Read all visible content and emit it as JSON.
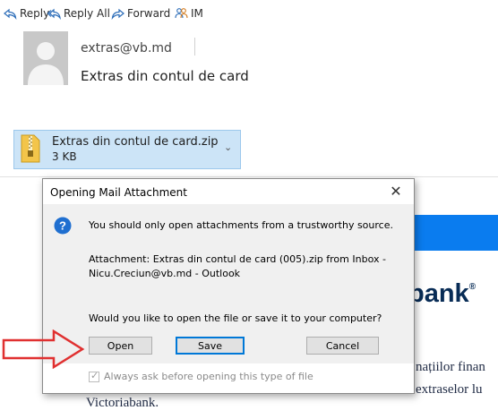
{
  "toolbar": {
    "reply_label": "Reply",
    "reply_all_label": "Reply All",
    "forward_label": "Forward",
    "im_label": "IM"
  },
  "message": {
    "from": "extras@vb.md",
    "subject": "Extras din contul de card"
  },
  "attachment": {
    "name": "Extras din contul de card.zip",
    "size": "3 KB"
  },
  "background": {
    "bank_text": "bank",
    "bank_mark": "®",
    "line1": "națiilor finan",
    "line2": "extraselor lu",
    "line3": "Victoriabank."
  },
  "dialog": {
    "title": "Opening Mail Attachment",
    "close_glyph": "✕",
    "warning": "You should only open attachments from a trustworthy source.",
    "attachment_line1": "Attachment: Extras din contul de card (005).zip from Inbox -",
    "attachment_line2": "Nicu.Creciun@vb.md - Outlook",
    "question": "Would you like to open the file or save it to your computer?",
    "open_label": "Open",
    "save_label": "Save",
    "cancel_label": "Cancel",
    "always_ask_label": "Always ask before opening this type of file",
    "always_ask_checked": true
  },
  "colors": {
    "accent": "#0078d7",
    "attachment_bg": "#cce4f7",
    "arrow": "#e03030",
    "bank_navy": "#082c56"
  },
  "icons": [
    "reply-icon",
    "reply-all-icon",
    "forward-icon",
    "im-icon",
    "zip-file-icon",
    "help-icon",
    "close-icon",
    "red-arrow-annotation"
  ]
}
